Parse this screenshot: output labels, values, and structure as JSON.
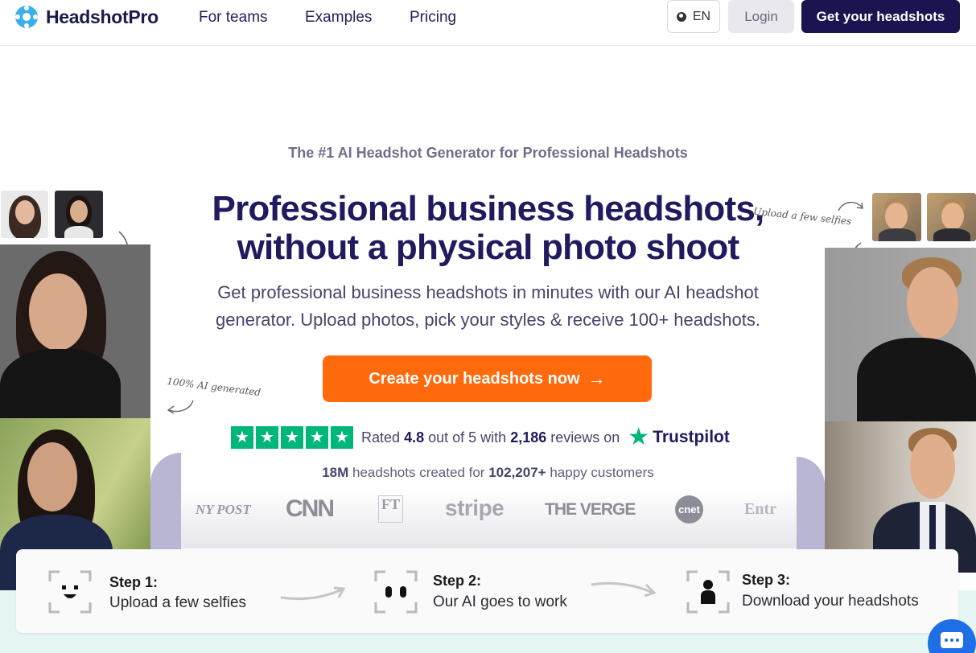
{
  "nav": {
    "brand": "HeadshotPro",
    "links": [
      "For teams",
      "Examples",
      "Pricing"
    ],
    "language": "EN",
    "login": "Login",
    "cta": "Get your headshots"
  },
  "hero": {
    "kicker": "The #1 AI Headshot Generator for Professional Headshots",
    "headline_line1": "Professional business headshots,",
    "headline_line2": "without a physical photo shoot",
    "subtext": "Get professional business headshots in minutes with our AI headshot generator. Upload photos, pick your styles & receive 100+ headshots.",
    "cta": "Create your headshots now",
    "cta_arrow": "→"
  },
  "rating": {
    "stars": 5,
    "prefix": "Rated",
    "score": "4.8",
    "mid": "out of 5 with",
    "reviews": "2,186",
    "suffix": "reviews on",
    "platform": "Trustpilot"
  },
  "stats": {
    "headshots": "18M",
    "mid": "headshots created for",
    "customers": "102,207+",
    "suffix": "happy customers"
  },
  "press_logos": [
    "NY POST",
    "CNN",
    "FT",
    "stripe",
    "THE VERGE",
    "cnet",
    "Entr"
  ],
  "annotations": {
    "left": "100% AI generated",
    "right": "Upload a few selfies"
  },
  "steps": [
    {
      "title": "Step 1:",
      "desc": "Upload a few selfies",
      "icon": "smiley-scan-icon"
    },
    {
      "title": "Step 2:",
      "desc": "Our AI goes to work",
      "icon": "eyes-scan-icon"
    },
    {
      "title": "Step 3:",
      "desc": "Download your headshots",
      "icon": "person-scan-icon"
    }
  ],
  "colors": {
    "brand_navy": "#1a1451",
    "cta_orange": "#ff6a0d",
    "trustpilot_green": "#00b67a",
    "chat_blue": "#1e6fe6"
  }
}
